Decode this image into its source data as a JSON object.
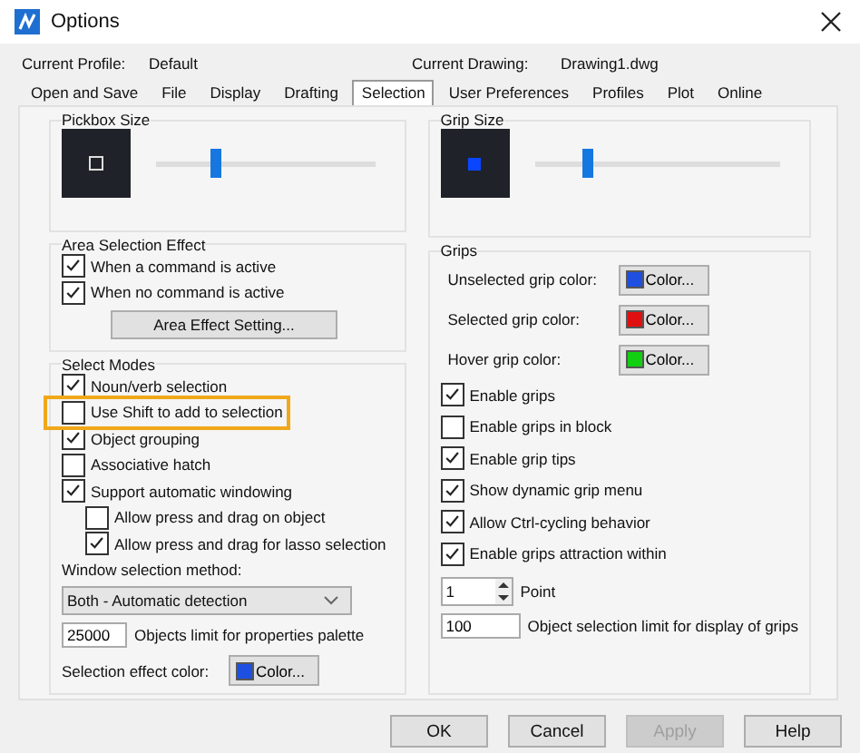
{
  "window": {
    "title": "Options"
  },
  "profile": {
    "label": "Current Profile:",
    "value": "Default"
  },
  "drawing": {
    "label": "Current Drawing:",
    "value": "Drawing1.dwg"
  },
  "tabs": [
    {
      "label": "Open and Save",
      "selected": false
    },
    {
      "label": "File",
      "selected": false
    },
    {
      "label": "Display",
      "selected": false
    },
    {
      "label": "Drafting",
      "selected": false
    },
    {
      "label": "Selection",
      "selected": true
    },
    {
      "label": "User Preferences",
      "selected": false
    },
    {
      "label": "Profiles",
      "selected": false
    },
    {
      "label": "Plot",
      "selected": false
    },
    {
      "label": "Online",
      "selected": false
    }
  ],
  "pickbox": {
    "title": "Pickbox Size",
    "level": 0.27
  },
  "area_selection": {
    "title": "Area Selection Effect",
    "options": [
      {
        "label": "When a command is active",
        "checked": true
      },
      {
        "label": "When no command is active",
        "checked": true
      }
    ],
    "button": "Area Effect Setting..."
  },
  "select_modes": {
    "title": "Select Modes",
    "options": [
      {
        "label": "Noun/verb selection",
        "checked": true,
        "highlighted": false
      },
      {
        "label": "Use Shift to add to selection",
        "checked": false,
        "highlighted": true
      },
      {
        "label": "Object grouping",
        "checked": true,
        "highlighted": false
      },
      {
        "label": "Associative hatch",
        "checked": false,
        "highlighted": false
      },
      {
        "label": "Support automatic windowing",
        "checked": true,
        "highlighted": false,
        "children": [
          {
            "label": "Allow press and drag on object",
            "checked": false
          },
          {
            "label": "Allow press and drag for lasso selection",
            "checked": true
          }
        ]
      }
    ],
    "method_label": "Window selection method:",
    "method_value": "Both - Automatic detection",
    "limit": {
      "value": "25000",
      "label": "Objects limit for properties palette"
    },
    "effect_color": {
      "label": "Selection effect color:",
      "button": "Color...",
      "color": "#1f4fe0"
    }
  },
  "grip_size": {
    "title": "Grip Size",
    "level": 0.22
  },
  "grips": {
    "title": "Grips",
    "colors": [
      {
        "label": "Unselected grip color:",
        "button": "Color...",
        "color": "#1f4fe0"
      },
      {
        "label": "Selected grip color:",
        "button": "Color...",
        "color": "#e01010"
      },
      {
        "label": "Hover grip color:",
        "button": "Color...",
        "color": "#10d010"
      }
    ],
    "options": [
      {
        "label": "Enable grips",
        "checked": true
      },
      {
        "label": "Enable grips in block",
        "checked": false
      },
      {
        "label": "Enable grip tips",
        "checked": true
      },
      {
        "label": "Show dynamic grip menu",
        "checked": true
      },
      {
        "label": "Allow Ctrl-cycling behavior",
        "checked": true
      },
      {
        "label": "Enable grips attraction within",
        "checked": true
      }
    ],
    "spinner": {
      "value": "1",
      "label": "Point"
    },
    "limit": {
      "value": "100",
      "label": "Object selection limit for display of grips"
    }
  },
  "buttons": [
    {
      "label": "OK",
      "disabled": false
    },
    {
      "label": "Cancel",
      "disabled": false
    },
    {
      "label": "Apply",
      "disabled": true
    },
    {
      "label": "Help",
      "disabled": false
    }
  ]
}
